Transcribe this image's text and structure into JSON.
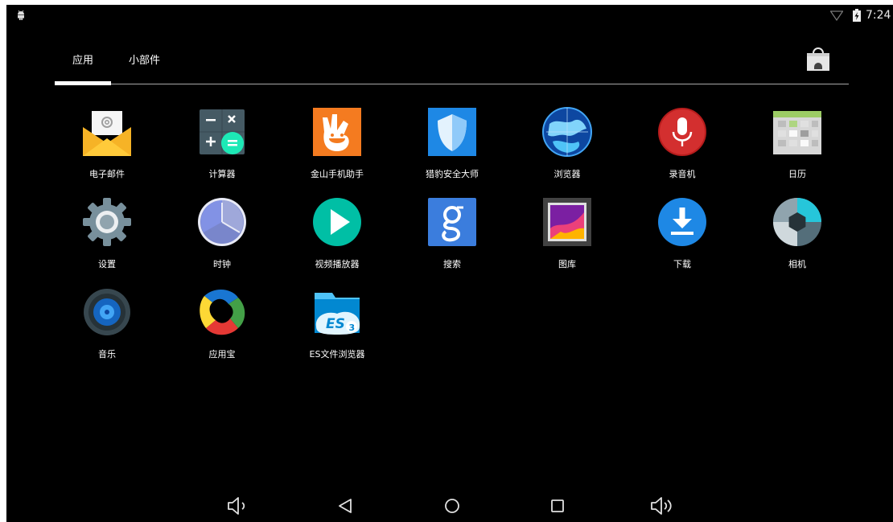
{
  "status_bar": {
    "time": "7:24",
    "icons": [
      "android-notification-icon",
      "wifi-icon",
      "battery-charging-icon"
    ]
  },
  "tabs": [
    {
      "label": "应用",
      "selected": true
    },
    {
      "label": "小部件",
      "selected": false
    }
  ],
  "store_icon": "play-store-bag-icon",
  "apps": [
    {
      "label": "电子邮件",
      "icon": "email-icon"
    },
    {
      "label": "计算器",
      "icon": "calculator-icon"
    },
    {
      "label": "金山手机助手",
      "icon": "kingsoft-assistant-icon"
    },
    {
      "label": "猎豹安全大师",
      "icon": "cm-security-shield-icon"
    },
    {
      "label": "浏览器",
      "icon": "browser-globe-icon"
    },
    {
      "label": "录音机",
      "icon": "sound-recorder-icon"
    },
    {
      "label": "日历",
      "icon": "calendar-icon"
    },
    {
      "label": "设置",
      "icon": "settings-gear-icon"
    },
    {
      "label": "时钟",
      "icon": "clock-icon"
    },
    {
      "label": "视频播放器",
      "icon": "video-player-icon"
    },
    {
      "label": "搜索",
      "icon": "google-search-icon"
    },
    {
      "label": "图库",
      "icon": "gallery-icon"
    },
    {
      "label": "下载",
      "icon": "downloads-icon"
    },
    {
      "label": "相机",
      "icon": "camera-icon"
    },
    {
      "label": "音乐",
      "icon": "music-icon"
    },
    {
      "label": "应用宝",
      "icon": "yingyongbao-icon"
    },
    {
      "label": "ES文件浏览器",
      "icon": "es-file-explorer-icon"
    }
  ],
  "nav_bar": [
    "volume-down-icon",
    "back-icon",
    "home-icon",
    "recents-icon",
    "volume-up-icon"
  ]
}
